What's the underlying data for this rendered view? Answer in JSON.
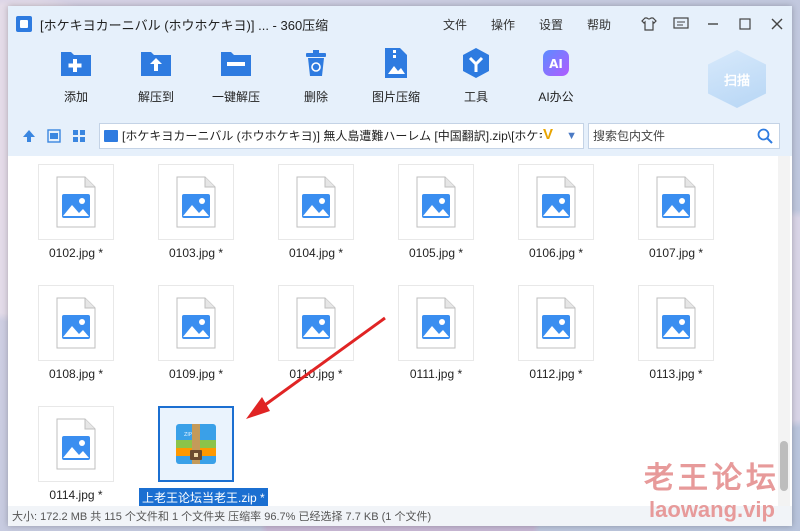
{
  "window": {
    "title": "[ホケキヨカーニバル (ホウホケキヨ)] ... - 360压缩"
  },
  "menu": [
    "文件",
    "操作",
    "设置",
    "帮助"
  ],
  "toolbar": {
    "tools": [
      {
        "label": "添加",
        "icon": "add-icon"
      },
      {
        "label": "解压到",
        "icon": "extract-to-icon"
      },
      {
        "label": "一键解压",
        "icon": "one-click-extract-icon"
      },
      {
        "label": "删除",
        "icon": "delete-icon"
      },
      {
        "label": "图片压缩",
        "icon": "image-compress-icon"
      },
      {
        "label": "工具",
        "icon": "tools-icon"
      },
      {
        "label": "AI办公",
        "icon": "ai-office-icon"
      }
    ],
    "scan_label": "扫描"
  },
  "address": {
    "path": "[ホケキヨカーニバル (ホウホケキヨ)] 無人島遭難ハーレム [中国翻訳].zip\\[ホケキヨ",
    "search_placeholder": "搜索包内文件"
  },
  "files": [
    {
      "name": "0102.jpg *",
      "type": "image"
    },
    {
      "name": "0103.jpg *",
      "type": "image"
    },
    {
      "name": "0104.jpg *",
      "type": "image"
    },
    {
      "name": "0105.jpg *",
      "type": "image"
    },
    {
      "name": "0106.jpg *",
      "type": "image"
    },
    {
      "name": "0107.jpg *",
      "type": "image"
    },
    {
      "name": "0108.jpg *",
      "type": "image"
    },
    {
      "name": "0109.jpg *",
      "type": "image"
    },
    {
      "name": "0110.jpg *",
      "type": "image"
    },
    {
      "name": "0111.jpg *",
      "type": "image"
    },
    {
      "name": "0112.jpg *",
      "type": "image"
    },
    {
      "name": "0113.jpg *",
      "type": "image"
    },
    {
      "name": "0114.jpg *",
      "type": "image"
    },
    {
      "name": "上老王论坛当老王.zip *",
      "type": "archive",
      "selected": true
    }
  ],
  "status": "大小: 172.2 MB 共 115 个文件和 1 个文件夹 压缩率 96.7% 已经选择 7.7 KB (1 个文件)",
  "watermark": {
    "cn": "老王论坛",
    "en": "laowang.vip"
  },
  "colors": {
    "accent": "#1b6fd1",
    "toolbar_bg": "#e6f0fb",
    "icon_blue": "#2e7be0"
  }
}
